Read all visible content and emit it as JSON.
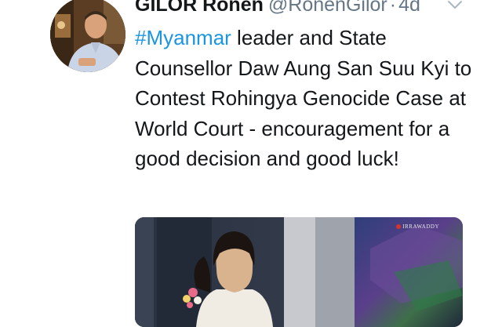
{
  "tweet": {
    "author": {
      "display_name": "GILOR Ronen",
      "handle": "@RonenGilor",
      "avatar_icon": "user-avatar-photo"
    },
    "separator": "·",
    "timestamp": "4d",
    "menu_icon": "chevron-down-icon",
    "text": {
      "hashtag": "#Myanmar",
      "body": " leader and State Counsellor Daw Aung San Suu Kyi to Contest Rohingya Genocide Case at World Court - encouragement for a good decision and good luck!"
    },
    "media": {
      "logo_text": "IRRAWADDY",
      "description_icon": "photo-media"
    }
  },
  "colors": {
    "text": "#14171a",
    "secondary": "#657786",
    "link": "#1b95e0",
    "background": "#ffffff"
  }
}
